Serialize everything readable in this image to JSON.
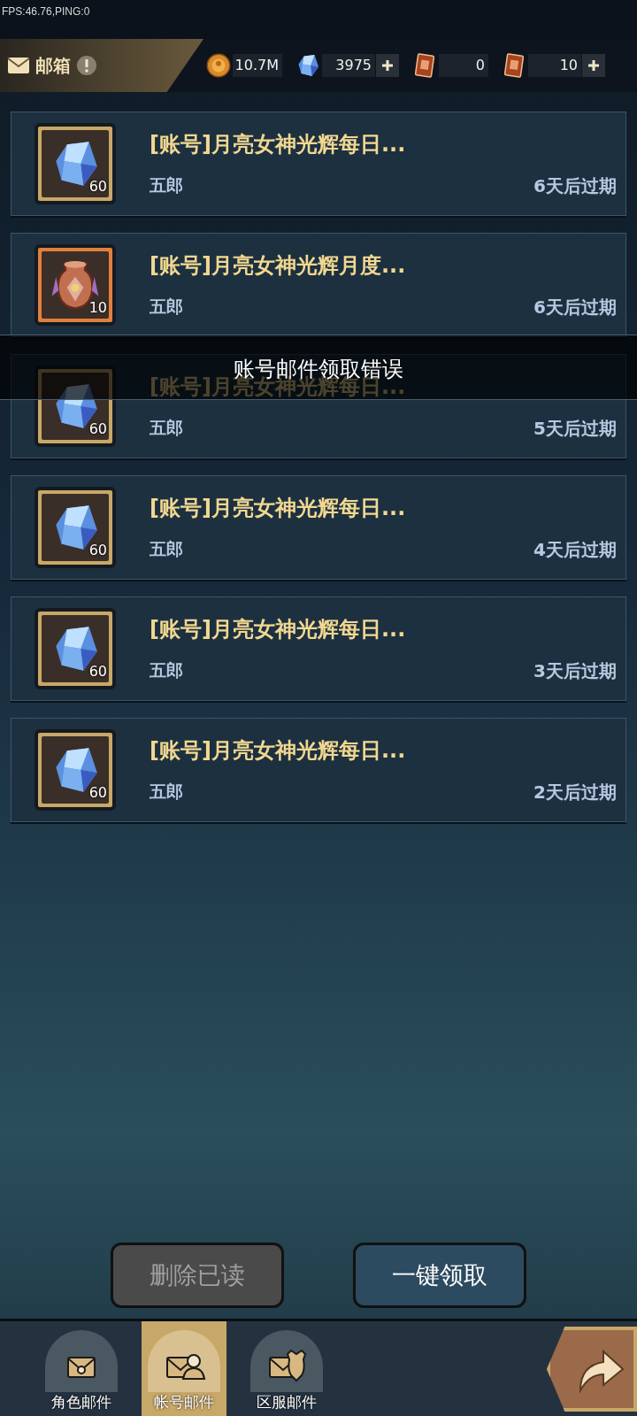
{
  "debug_overlay": "FPS:46.76,PING:0",
  "header": {
    "title": "邮箱",
    "resources": [
      {
        "kind": "coin",
        "value": "10.7M",
        "plus": false
      },
      {
        "kind": "crystal",
        "value": "3975",
        "plus": true
      },
      {
        "kind": "card",
        "value": "0",
        "plus": false
      },
      {
        "kind": "card",
        "value": "10",
        "plus": true
      }
    ]
  },
  "mails": [
    {
      "kind": "crystal",
      "count": "60",
      "title": "[账号]月亮女神光辉每日...",
      "sender": "五郎",
      "expiry": "6天后过期"
    },
    {
      "kind": "vase",
      "count": "10",
      "title": "[账号]月亮女神光辉月度...",
      "sender": "五郎",
      "expiry": "6天后过期"
    },
    {
      "kind": "crystal",
      "count": "60",
      "title": "[账号]月亮女神光辉每日...",
      "sender": "五郎",
      "expiry": "5天后过期"
    },
    {
      "kind": "crystal",
      "count": "60",
      "title": "[账号]月亮女神光辉每日...",
      "sender": "五郎",
      "expiry": "4天后过期"
    },
    {
      "kind": "crystal",
      "count": "60",
      "title": "[账号]月亮女神光辉每日...",
      "sender": "五郎",
      "expiry": "3天后过期"
    },
    {
      "kind": "crystal",
      "count": "60",
      "title": "[账号]月亮女神光辉每日...",
      "sender": "五郎",
      "expiry": "2天后过期"
    }
  ],
  "toast": "账号邮件领取错误",
  "buttons": [
    {
      "label": "删除已读",
      "disabled": true
    },
    {
      "label": "一键领取",
      "disabled": false
    }
  ],
  "tabs": [
    {
      "kind": "role",
      "label": "角色邮件",
      "selected": false
    },
    {
      "kind": "account",
      "label": "帐号邮件",
      "selected": true
    },
    {
      "kind": "server",
      "label": "区服邮件",
      "selected": false
    }
  ]
}
